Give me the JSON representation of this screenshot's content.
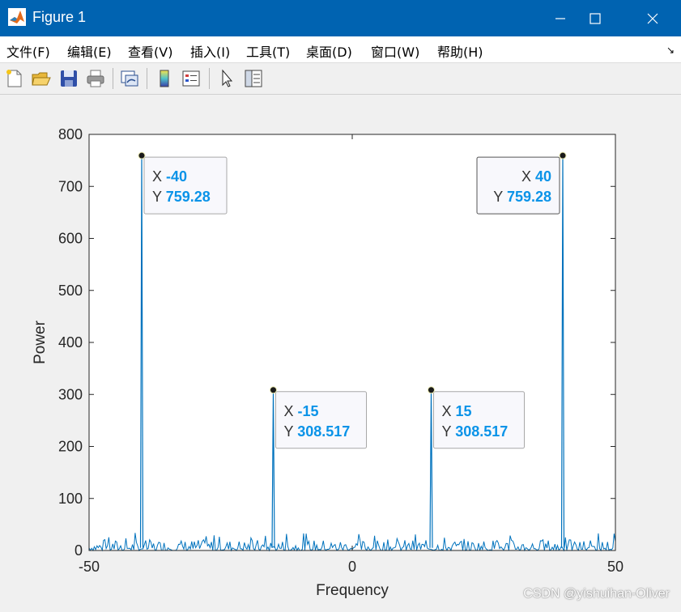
{
  "window": {
    "title": "Figure 1",
    "icons": [
      "matlab-logo-icon",
      "minimize-icon",
      "maximize-icon",
      "close-icon"
    ]
  },
  "menu": {
    "items": [
      "文件(F)",
      "编辑(E)",
      "查看(V)",
      "插入(I)",
      "工具(T)",
      "桌面(D)",
      "窗口(W)",
      "帮助(H)"
    ],
    "dock_glyph": "↘"
  },
  "toolbar": {
    "icons": [
      "new-figure-icon",
      "open-file-icon",
      "save-icon",
      "print-icon",
      "link-plot-icon",
      "colorbar-icon",
      "legend-icon",
      "select-arrow-icon",
      "property-inspector-icon"
    ]
  },
  "chart_data": {
    "type": "line",
    "title": "",
    "xlabel": "Frequency",
    "ylabel": "Power",
    "xlim": [
      -50,
      50
    ],
    "ylim": [
      0,
      800
    ],
    "xticks": [
      -50,
      0,
      50
    ],
    "yticks": [
      0,
      100,
      200,
      300,
      400,
      500,
      600,
      700,
      800
    ],
    "grid": false,
    "line_color": "#0072bd",
    "series": [
      {
        "peaks": [
          {
            "x": -40,
            "y": 759.28
          },
          {
            "x": -15,
            "y": 308.517
          },
          {
            "x": 15,
            "y": 308.517
          },
          {
            "x": 40,
            "y": 759.28
          }
        ],
        "noise_floor_max": 35
      }
    ],
    "datatips": [
      {
        "x": "-40",
        "y": "759.28",
        "x_label": "X",
        "y_label": "Y",
        "placement": "right"
      },
      {
        "x": "-15",
        "y": "308.517",
        "x_label": "X",
        "y_label": "Y",
        "placement": "right"
      },
      {
        "x": "15",
        "y": "308.517",
        "x_label": "X",
        "y_label": "Y",
        "placement": "right"
      },
      {
        "x": "40",
        "y": "759.28",
        "x_label": "X",
        "y_label": "Y",
        "placement": "left"
      }
    ]
  },
  "watermark": "CSDN @yishuihan-Oliver"
}
